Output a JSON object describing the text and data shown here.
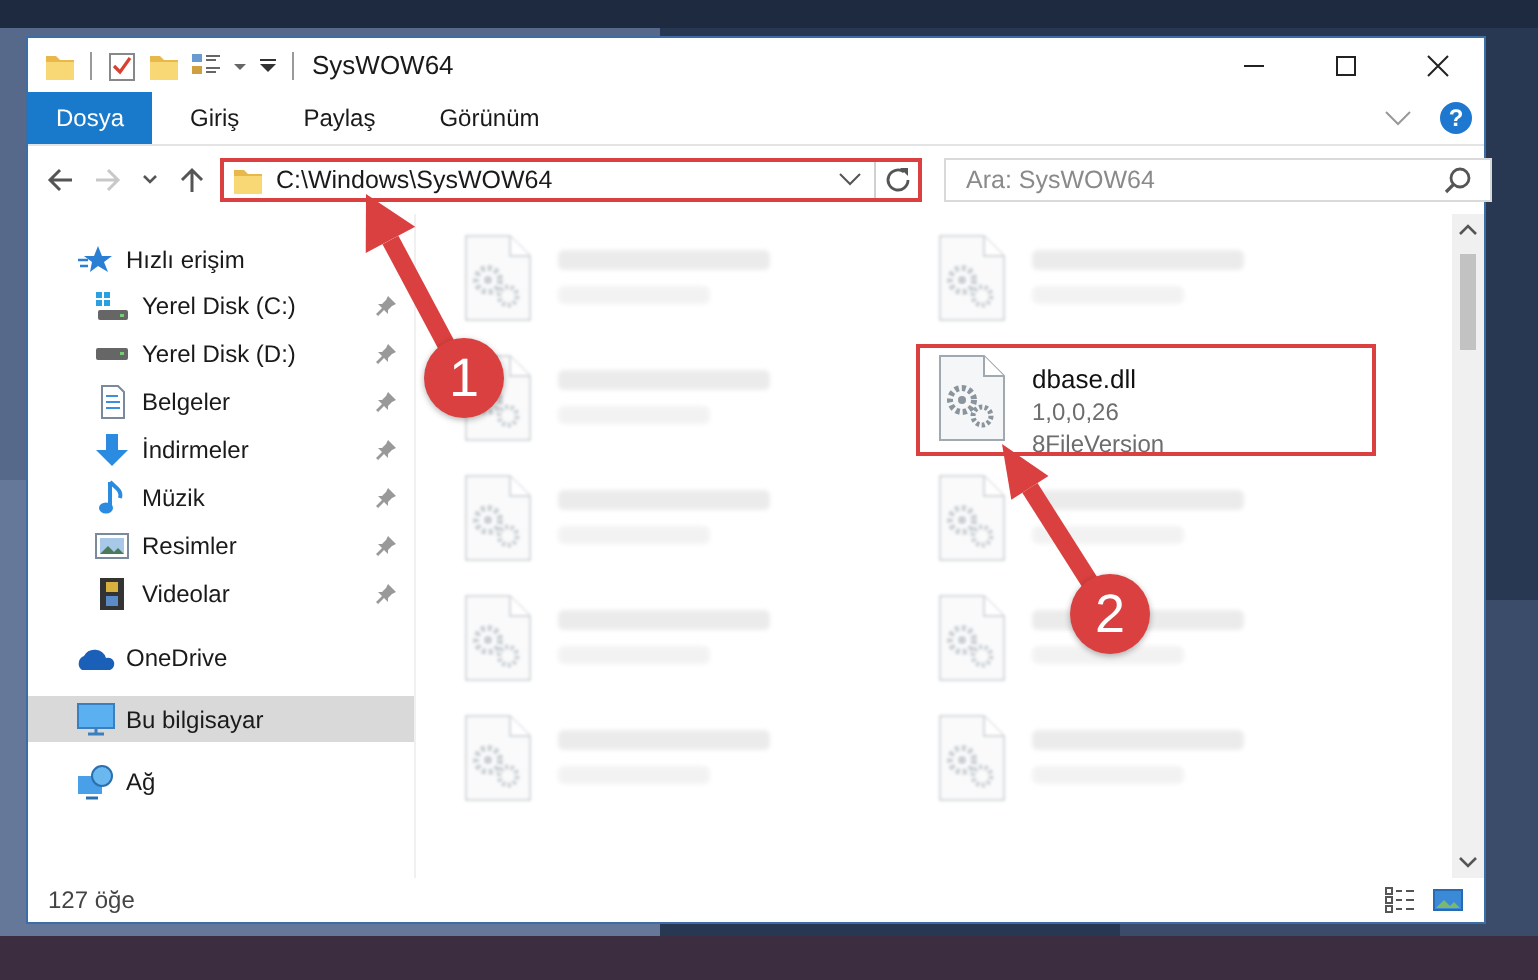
{
  "window": {
    "title": "SysWOW64",
    "help": "?"
  },
  "ribbon_tabs": [
    {
      "label": "Dosya",
      "selected": true
    },
    {
      "label": "Giriş",
      "selected": false
    },
    {
      "label": "Paylaş",
      "selected": false
    },
    {
      "label": "Görünüm",
      "selected": false
    }
  ],
  "nav_buttons": [
    {
      "kind": "back",
      "disabled": false
    },
    {
      "kind": "forward",
      "disabled": true
    },
    {
      "kind": "recent",
      "disabled": false
    },
    {
      "kind": "up",
      "disabled": false
    }
  ],
  "address_bar": {
    "path": "C:\\Windows\\SysWOW64",
    "highlighted": true
  },
  "search": {
    "placeholder": "Ara: SysWOW64"
  },
  "sidebar": {
    "items": [
      {
        "label": "Hızlı erişim",
        "kind": "star",
        "selected": false,
        "children": [
          {
            "label": "Yerel Disk (C:)",
            "kind": "windisk",
            "selected": false,
            "pinned": true
          },
          {
            "label": "Yerel Disk (D:)",
            "kind": "disk",
            "selected": false,
            "pinned": true
          },
          {
            "label": "Belgeler",
            "kind": "documents",
            "selected": false,
            "pinned": true
          },
          {
            "label": "İndirmeler",
            "kind": "downloads",
            "selected": false,
            "pinned": true
          },
          {
            "label": "Müzik",
            "kind": "music",
            "selected": false,
            "pinned": true
          },
          {
            "label": "Resimler",
            "kind": "pictures",
            "selected": false,
            "pinned": true
          },
          {
            "label": "Videolar",
            "kind": "videos",
            "selected": false,
            "pinned": true
          }
        ]
      },
      {
        "label": "OneDrive",
        "kind": "cloud",
        "selected": false
      },
      {
        "label": "Bu bilgisayar",
        "kind": "computer",
        "selected": true
      },
      {
        "label": "Ağ",
        "kind": "network",
        "selected": false
      }
    ]
  },
  "files": [
    {
      "blurred": true
    },
    {
      "blurred": true
    },
    {
      "blurred": true
    },
    {
      "name": "dbase.dll",
      "lines": [
        "1,0,0,26",
        "8FileVersion"
      ],
      "blurred": false,
      "highlighted": true
    },
    {
      "blurred": true
    },
    {
      "blurred": true
    },
    {
      "blurred": true
    },
    {
      "blurred": true
    },
    {
      "blurred": true
    },
    {
      "blurred": true
    }
  ],
  "status_bar": {
    "count": "127 öğe"
  },
  "annotations": [
    {
      "number": "1"
    },
    {
      "number": "2"
    }
  ]
}
